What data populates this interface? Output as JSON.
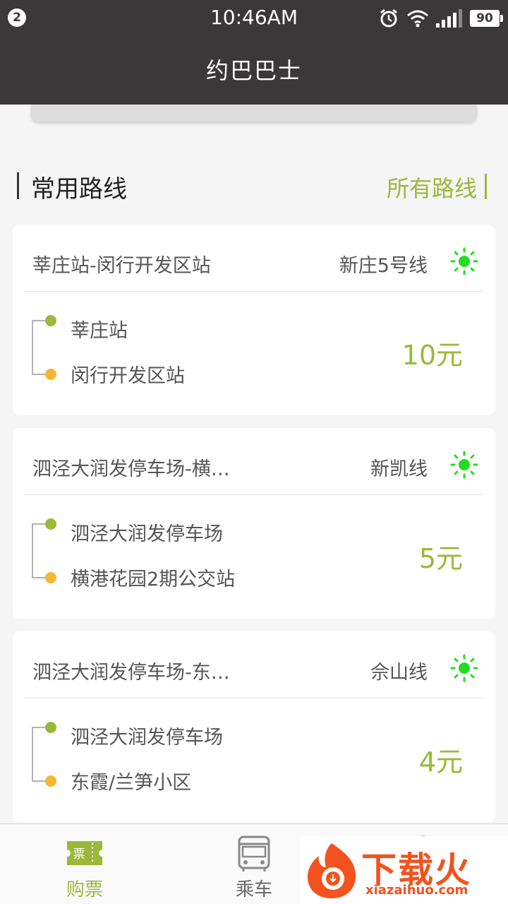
{
  "statusbar": {
    "notification_count": "2",
    "time": "10:46AM",
    "battery": "90"
  },
  "header": {
    "title": "约巴巴士"
  },
  "section": {
    "title": "常用路线",
    "all_routes_link": "所有路线"
  },
  "routes": [
    {
      "route": "莘庄站-闵行开发区站",
      "line": "新庄5号线",
      "from": "莘庄站",
      "to": "闵行开发区站",
      "price": "10元"
    },
    {
      "route": "泗泾大润发停车场-横…",
      "line": "新凯线",
      "from": "泗泾大润发停车场",
      "to": "横港花园2期公交站",
      "price": "5元"
    },
    {
      "route": "泗泾大润发停车场-东…",
      "line": "佘山线",
      "from": "泗泾大润发停车场",
      "to": "东霞/兰笋小区",
      "price": "4元"
    }
  ],
  "tabbar": {
    "tabs": [
      {
        "label": "购票",
        "icon": "ticket-icon",
        "icon_text": "票",
        "active": true
      },
      {
        "label": "乘车",
        "icon": "bus-icon",
        "active": false
      },
      {
        "label": "",
        "icon": "user-icon",
        "active": false
      }
    ]
  },
  "watermark": {
    "text": "下载火",
    "domain": "xiazaihuo.com"
  },
  "colors": {
    "accent": "#9bb83a",
    "header_bg": "#3a3839",
    "sun": "#22dd22",
    "dot_start": "#9bb83a",
    "dot_end": "#f5b731"
  }
}
